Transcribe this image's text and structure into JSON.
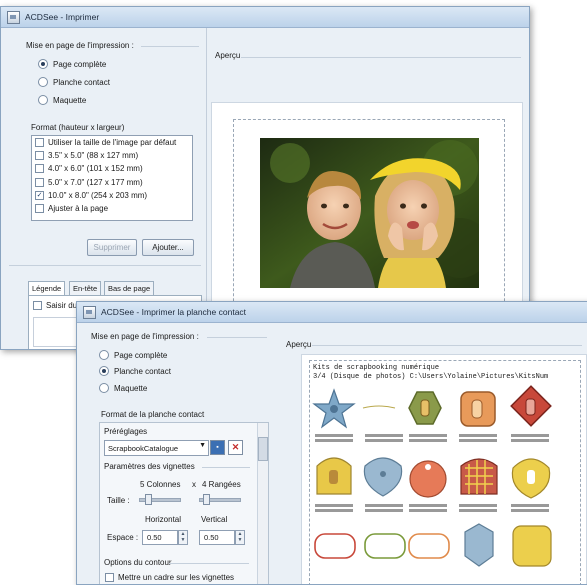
{
  "window1": {
    "title": "ACDSee - Imprimer",
    "layout_group_label": "Mise en page de l'impression :",
    "layout_options": [
      {
        "label": "Page complète",
        "selected": true
      },
      {
        "label": "Planche contact",
        "selected": false
      },
      {
        "label": "Maquette",
        "selected": false
      }
    ],
    "format_label": "Format (hauteur x largeur)",
    "format_items": [
      {
        "label": "Utiliser la taille de l'image par défaut",
        "checked": false
      },
      {
        "label": "3.5\" x 5.0\" (88 x 127 mm)",
        "checked": false
      },
      {
        "label": "4.0\" x 6.0\" (101 x 152 mm)",
        "checked": false
      },
      {
        "label": "5.0\" x 7.0\" (127 x 177 mm)",
        "checked": false
      },
      {
        "label": "10.0\" x 8.0\" (254 x 203 mm)",
        "checked": true
      },
      {
        "label": "Ajuster à la page",
        "checked": false
      }
    ],
    "delete_button": "Supprimer",
    "add_button": "Ajouter...",
    "tabs": [
      "Légende",
      "En-tête",
      "Bas de page"
    ],
    "caption_checkbox": "Saisir du",
    "preview_label": "Aperçu"
  },
  "window2": {
    "title": "ACDSee - Imprimer la planche contact",
    "layout_group_label": "Mise en page de l'impression :",
    "layout_options": [
      {
        "label": "Page complète",
        "selected": false
      },
      {
        "label": "Planche contact",
        "selected": true
      },
      {
        "label": "Maquette",
        "selected": false
      }
    ],
    "sheet_format_label": "Format de la planche contact",
    "presets_label": "Préréglages",
    "preset_value": "ScrapbookCatalogue",
    "thumbnail_params_label": "Paramètres des vignettes",
    "columns_text": "5 Colonnes",
    "times_sign": "x",
    "rows_text": "4 Rangées",
    "size_label": "Taille :",
    "horizontal_label": "Horizontal",
    "vertical_label": "Vertical",
    "spacing_label": "Espace :",
    "horizontal_value": "0.50",
    "vertical_value": "0.50",
    "border_options_label": "Options du contour",
    "border_checkbox": "Mettre un cadre sur les vignettes",
    "preview_label": "Aperçu",
    "sheet_title_line1": "Kits de scrapbooking numérique",
    "sheet_title_line2": "3/4 (Disque de photos)  C:\\Users\\Yolaine\\Pictures\\KitsNum",
    "thumb_caption": "circle-emebellissements",
    "colors": {
      "star": "#7fa8c8",
      "green": "#8a9a4a",
      "orange": "#e89a5a",
      "red": "#c8483a",
      "yellow": "#e8c848",
      "blue": "#9ab8d0",
      "plaid": "#c85a48",
      "teal": "#6ab8b0"
    }
  }
}
